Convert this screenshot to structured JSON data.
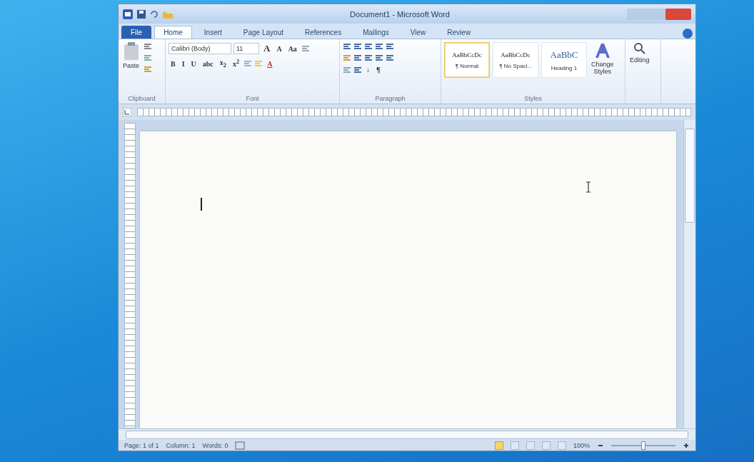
{
  "window": {
    "title": "Document1 - Microsoft Word"
  },
  "tabs": [
    {
      "label": "File",
      "kind": "file",
      "selected": false
    },
    {
      "label": "Home",
      "kind": "tab",
      "selected": true
    },
    {
      "label": "Insert",
      "kind": "tab",
      "selected": false
    },
    {
      "label": "Page Layout",
      "kind": "tab",
      "selected": false
    },
    {
      "label": "References",
      "kind": "tab",
      "selected": false
    },
    {
      "label": "Mailings",
      "kind": "tab",
      "selected": false
    },
    {
      "label": "View",
      "kind": "tab",
      "selected": false
    },
    {
      "label": "Review",
      "kind": "tab",
      "selected": false
    }
  ],
  "ribbon": {
    "clipboard": {
      "paste": "Paste",
      "group": "Clipboard"
    },
    "font": {
      "name": "Calibri (Body)",
      "size": "11",
      "grow": "A",
      "shrink": "A",
      "case": "Aa",
      "format_buttons": [
        "B",
        "I",
        "U",
        "abc",
        "x$_{2}$",
        "x$^{2}$"
      ],
      "color_button": "A",
      "group": "Font"
    },
    "paragraph": {
      "group": "Paragraph",
      "sort": "↓",
      "pilcrow": "¶"
    },
    "styles": {
      "group": "Styles",
      "items": [
        {
          "preview": "AaBbCcDc",
          "name": "¶ Normal",
          "selected": true
        },
        {
          "preview": "AaBbCcDc",
          "name": "¶ No Spaci...",
          "selected": false
        },
        {
          "preview": "AaBbC",
          "name": "Heading 1",
          "selected": false
        }
      ],
      "change_styles": [
        "Change",
        "Styles"
      ]
    },
    "editing": {
      "label": "Editing"
    }
  },
  "status_bar": {
    "page": "Page: 1 of 1",
    "column": "Column: 1",
    "words": "Words: 0",
    "views": [
      {
        "selected": true
      },
      {
        "selected": false
      },
      {
        "selected": false
      },
      {
        "selected": false
      },
      {
        "selected": false
      }
    ],
    "zoom": "100%",
    "zoom_level": {
      "level": 0.5
    }
  }
}
